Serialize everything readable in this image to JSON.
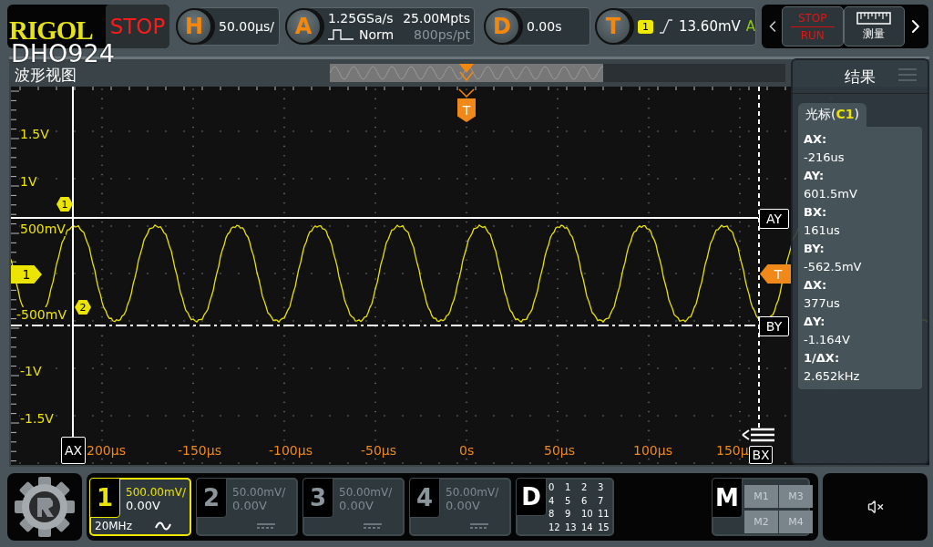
{
  "header": {
    "brand": "RIGOL",
    "run_state": "STOP",
    "model": "DHO924"
  },
  "horizontal": {
    "key": "H",
    "scale": "50.00μs/"
  },
  "acquisition": {
    "key": "A",
    "sample_rate": "1.25GSa/s",
    "mode": "Norm",
    "memory_depth": "25.00Mpts",
    "time_per_point": "800ps/pt"
  },
  "delay": {
    "key": "D",
    "value": "0.00s"
  },
  "trigger": {
    "key": "T",
    "source": "1",
    "level": "13.60mV",
    "sweep": "A"
  },
  "toolbar": {
    "stop": "STOP",
    "run": "RUN",
    "measure": "测量"
  },
  "waveform_view": {
    "title": "波形视图",
    "trigger_time_marker": "T",
    "trigger_level_marker": "T",
    "channel_marker": "1",
    "y_labels": [
      "1.5V",
      "1V",
      "500mV",
      "-500mV",
      "-1V",
      "-1.5V"
    ],
    "x_labels": [
      "200μs",
      "-150μs",
      "-100μs",
      "-50μs",
      "0s",
      "50μs",
      "100μs",
      "150μ"
    ],
    "cursors": {
      "ax": "AX",
      "bx": "BX",
      "ay": "AY",
      "by": "BY"
    },
    "cursor_badges": [
      "1",
      "2"
    ]
  },
  "results": {
    "title": "结果",
    "tab": {
      "prefix": "光标(",
      "source": "C1",
      "suffix": ")"
    },
    "readings": [
      {
        "label": "AX:",
        "value": "-216us"
      },
      {
        "label": "AY:",
        "value": "601.5mV"
      },
      {
        "label": "BX:",
        "value": "161us"
      },
      {
        "label": "BY:",
        "value": "-562.5mV"
      },
      {
        "label": "ΔX:",
        "value": "377us"
      },
      {
        "label": "ΔY:",
        "value": "-1.164V"
      },
      {
        "label": "1/ΔX:",
        "value": "2.652kHz"
      }
    ]
  },
  "channels": [
    {
      "number": "1",
      "scale": "500.00mV/",
      "offset": "0.00V",
      "bandwidth": "20MHz",
      "kind": "ac",
      "selected": true
    },
    {
      "number": "2",
      "scale": "50.00mV/",
      "offset": "0.00V",
      "kind": "dc",
      "selected": false
    },
    {
      "number": "3",
      "scale": "50.00mV/",
      "offset": "0.00V",
      "kind": "dc",
      "selected": false
    },
    {
      "number": "4",
      "scale": "50.00mV/",
      "offset": "0.00V",
      "kind": "dc",
      "selected": false
    }
  ],
  "digital": {
    "key": "D",
    "bits": [
      "0",
      "1",
      "2",
      "3",
      "4",
      "5",
      "6",
      "7",
      "8",
      "9",
      "10",
      "11",
      "12",
      "13",
      "14",
      "15"
    ]
  },
  "math": {
    "key": "M",
    "slots": [
      "M1",
      "M3",
      "M2",
      "M4"
    ]
  },
  "audio": {
    "muted": true
  }
}
